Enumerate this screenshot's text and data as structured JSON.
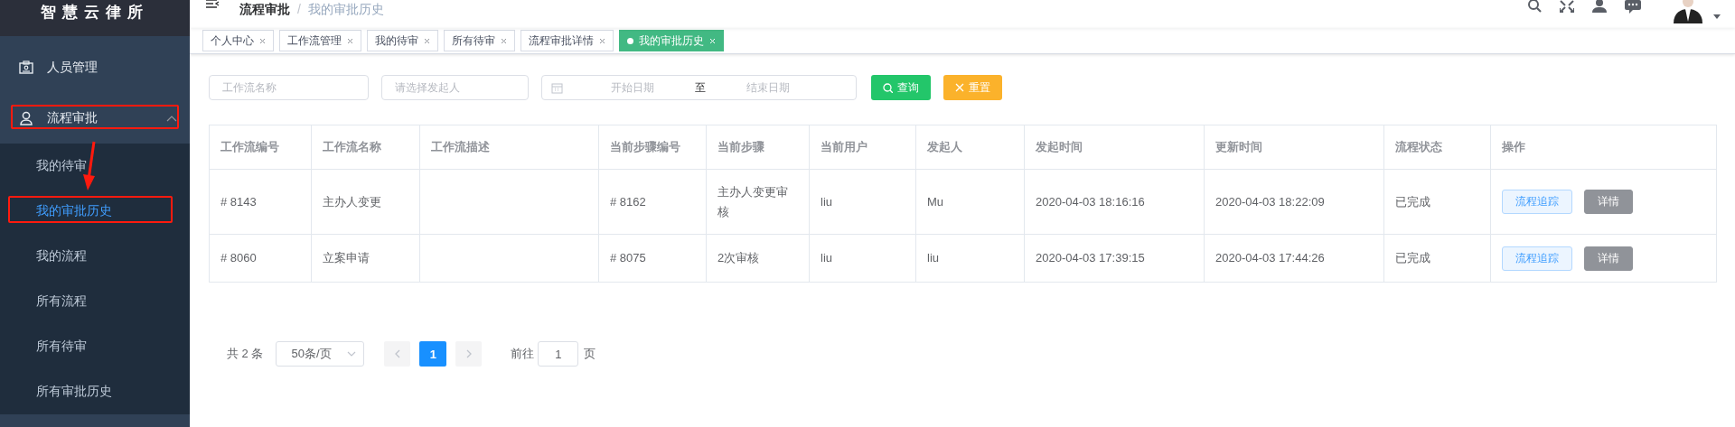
{
  "sidebar": {
    "logo": "智慧云律所",
    "items": [
      {
        "label": "人员管理"
      },
      {
        "label": "流程审批",
        "expanded": true,
        "children": [
          {
            "label": "我的待审",
            "selected": false
          },
          {
            "label": "我的审批历史",
            "selected": true
          },
          {
            "label": "我的流程",
            "selected": false
          },
          {
            "label": "所有流程",
            "selected": false
          },
          {
            "label": "所有待审",
            "selected": false
          },
          {
            "label": "所有审批历史",
            "selected": false
          }
        ]
      }
    ]
  },
  "header": {
    "breadcrumb": [
      "流程审批",
      "我的审批历史"
    ],
    "separator": "/"
  },
  "tabs": [
    {
      "label": "个人中心",
      "selected": false
    },
    {
      "label": "工作流管理",
      "selected": false
    },
    {
      "label": "我的待审",
      "selected": false
    },
    {
      "label": "所有待审",
      "selected": false
    },
    {
      "label": "流程审批详情",
      "selected": false
    },
    {
      "label": "我的审批历史",
      "selected": true
    }
  ],
  "filters": {
    "workflow_name": {
      "placeholder": "工作流名称"
    },
    "initiator": {
      "placeholder": "请选择发起人"
    },
    "date_range": {
      "start_placeholder": "开始日期",
      "separator": "至",
      "end_placeholder": "结束日期"
    },
    "buttons": [
      {
        "label": "查询",
        "kind": "search"
      },
      {
        "label": "重置",
        "kind": "reset"
      }
    ]
  },
  "table": {
    "columns": [
      "工作流编号",
      "工作流名称",
      "工作流描述",
      "当前步骤编号",
      "当前步骤",
      "当前用户",
      "发起人",
      "发起时间",
      "更新时间",
      "流程状态",
      "操作"
    ],
    "rows": [
      {
        "cells": [
          "# 8143",
          "主办人变更",
          "",
          "# 8162",
          "主办人变更审核",
          "liu",
          "Mu",
          "2020-04-03 18:16:16",
          "2020-04-03 18:22:09",
          "已完成"
        ],
        "actions": [
          {
            "label": "流程追踪",
            "kind": "plain"
          },
          {
            "label": "详情",
            "kind": "info"
          }
        ]
      },
      {
        "cells": [
          "# 8060",
          "立案申请",
          "",
          "# 8075",
          "2次审核",
          "liu",
          "liu",
          "2020-04-03 17:39:15",
          "2020-04-03 17:44:26",
          "已完成"
        ],
        "actions": [
          {
            "label": "流程追踪",
            "kind": "plain"
          },
          {
            "label": "详情",
            "kind": "info"
          }
        ]
      }
    ]
  },
  "pagination": {
    "total": "共 2 条",
    "page_size": "50条/页",
    "pages": [
      {
        "label": "1",
        "selected": true
      }
    ],
    "goto_label": "前往",
    "goto_value": "1",
    "page_suffix": "页"
  }
}
